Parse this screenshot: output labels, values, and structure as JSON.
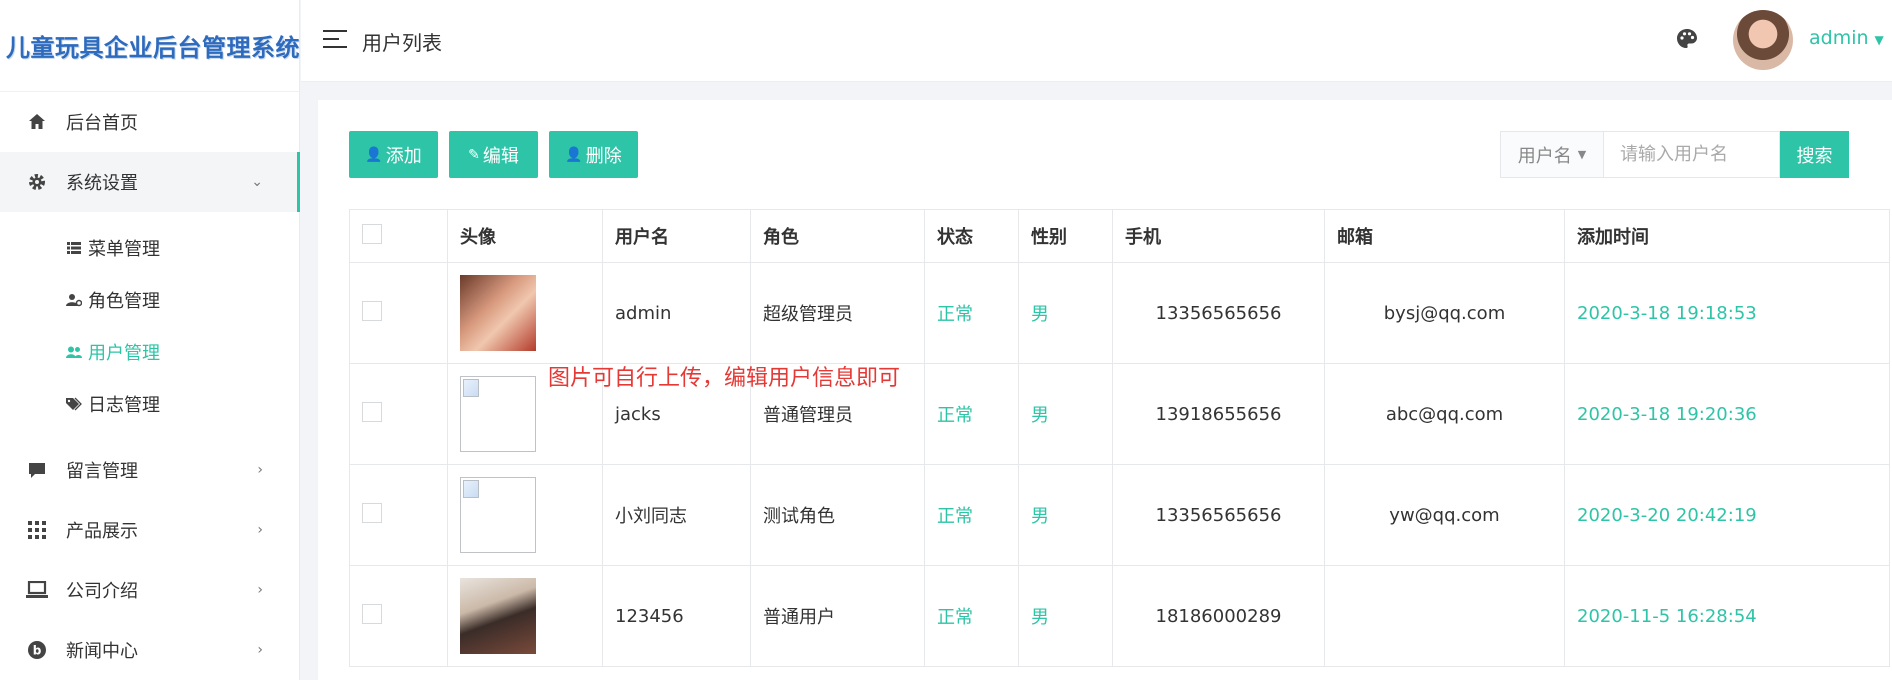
{
  "app": {
    "title": "儿童玩具企业后台管理系统"
  },
  "sidebar": {
    "items": [
      {
        "label": "后台首页",
        "icon": "home-icon"
      },
      {
        "label": "系统设置",
        "icon": "gear-icon",
        "expanded": true
      },
      {
        "label": "留言管理",
        "icon": "comment-icon"
      },
      {
        "label": "产品展示",
        "icon": "grid-icon"
      },
      {
        "label": "公司介绍",
        "icon": "laptop-icon"
      },
      {
        "label": "新闻中心",
        "icon": "news-icon"
      }
    ],
    "submenu": [
      {
        "label": "菜单管理",
        "icon": "list-icon"
      },
      {
        "label": "角色管理",
        "icon": "user-gear-icon"
      },
      {
        "label": "用户管理",
        "icon": "users-icon",
        "active": true
      },
      {
        "label": "日志管理",
        "icon": "tag-icon"
      }
    ]
  },
  "header": {
    "page_title": "用户列表",
    "username": "admin"
  },
  "toolbar": {
    "add_label": "添加",
    "edit_label": "编辑",
    "delete_label": "删除"
  },
  "search": {
    "field": "用户名",
    "placeholder": "请输入用户名",
    "button": "搜索"
  },
  "table": {
    "headers": [
      "头像",
      "用户名",
      "角色",
      "状态",
      "性别",
      "手机",
      "邮箱",
      "添加时间"
    ],
    "rows": [
      {
        "username": "admin",
        "role": "超级管理员",
        "status": "正常",
        "gender": "男",
        "phone": "13356565656",
        "email": "bysj@qq.com",
        "time": "2020-3-18 19:18:53"
      },
      {
        "username": "jacks",
        "role": "普通管理员",
        "status": "正常",
        "gender": "男",
        "phone": "13918655656",
        "email": "abc@qq.com",
        "time": "2020-3-18 19:20:36"
      },
      {
        "username": "小刘同志",
        "role": "测试角色",
        "status": "正常",
        "gender": "男",
        "phone": "13356565656",
        "email": "yw@qq.com",
        "time": "2020-3-20 20:42:19"
      },
      {
        "username": "123456",
        "role": "普通用户",
        "status": "正常",
        "gender": "男",
        "phone": "18186000289",
        "email": "",
        "time": "2020-11-5 16:28:54"
      }
    ]
  },
  "annotation": "图片可自行上传，编辑用户信息即可",
  "colors": {
    "accent": "#2ec4a7",
    "note": "#e53935",
    "logo": "#2f6bbd"
  }
}
